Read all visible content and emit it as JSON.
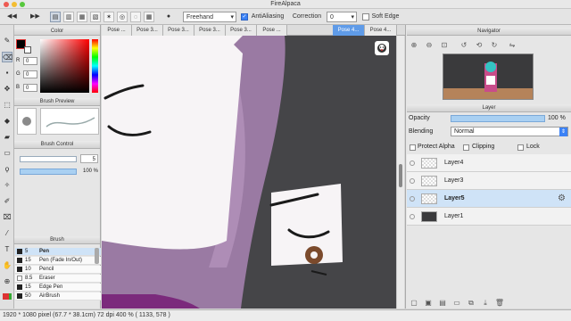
{
  "window": {
    "title": "FireAlpaca"
  },
  "toolbar": {
    "brush_mode": "Freehand",
    "antialias_label": "AntiAliasing",
    "correction_label": "Correction",
    "correction_value": "0",
    "softedge_label": "Soft Edge",
    "antialias_checked": "✓"
  },
  "tabs": [
    "Pose ...",
    "Pose 3...",
    "Pose 3...",
    "Pose 3...",
    "Pose 3...",
    "Pose ...",
    "Pose 4...",
    "Pose 4..."
  ],
  "left": {
    "color_header": "Color",
    "rgb": [
      {
        "label": "R",
        "value": "0"
      },
      {
        "label": "G",
        "value": "0"
      },
      {
        "label": "B",
        "value": "0"
      }
    ],
    "brush_preview_header": "Brush Preview",
    "brush_control_header": "Brush Control",
    "brush_size": "5",
    "brush_opacity": "100 %",
    "brush_header": "Brush",
    "brushes": [
      {
        "size": "5",
        "name": "Pen"
      },
      {
        "size": "15",
        "name": "Pen (Fade In/Out)"
      },
      {
        "size": "10",
        "name": "Pencil"
      },
      {
        "size": "8.5",
        "name": "Eraser"
      },
      {
        "size": "15",
        "name": "Edge Pen"
      },
      {
        "size": "50",
        "name": "AirBrush"
      }
    ]
  },
  "right": {
    "navigator_header": "Navigator",
    "layer_header": "Layer",
    "opacity_label": "Opacity",
    "opacity_value": "100 %",
    "blending_label": "Blending",
    "blending_value": "Normal",
    "protect_alpha": "Protect Alpha",
    "clipping": "Clipping",
    "lock": "Lock",
    "layers": [
      "Layer4",
      "Layer3",
      "Layer5",
      "Layer1"
    ]
  },
  "status": {
    "text": "1920 * 1080 pixel   (67.7 * 38.1cm)   72 dpi   400 %   ( 1133, 578 )"
  },
  "colors": {
    "accent": "#5f9be8",
    "canvas_bg": "#454548",
    "skin": "#f7f4f6",
    "purple": "#9a7aa3"
  }
}
